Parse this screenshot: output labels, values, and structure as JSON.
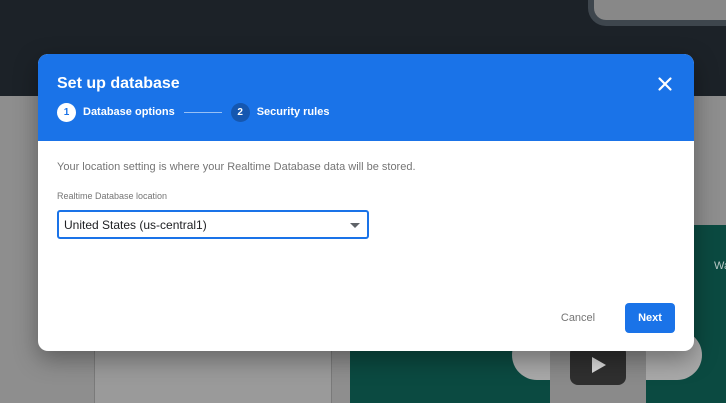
{
  "background": {
    "promo_text": "Wa"
  },
  "dialog": {
    "title": "Set up database",
    "close_icon": "close-icon",
    "steps": [
      {
        "number": "1",
        "label": "Database options",
        "active": true
      },
      {
        "number": "2",
        "label": "Security rules",
        "active": false
      }
    ],
    "description": "Your location setting is where your Realtime Database data will be stored.",
    "location_field": {
      "label": "Realtime Database location",
      "value": "United States (us-central1)"
    },
    "cancel_label": "Cancel",
    "next_label": "Next"
  },
  "colors": {
    "header": "#1a73e8",
    "primary_button": "#1a73e8",
    "background_header": "#1c2228",
    "promo_panel": "#0b4a41"
  }
}
